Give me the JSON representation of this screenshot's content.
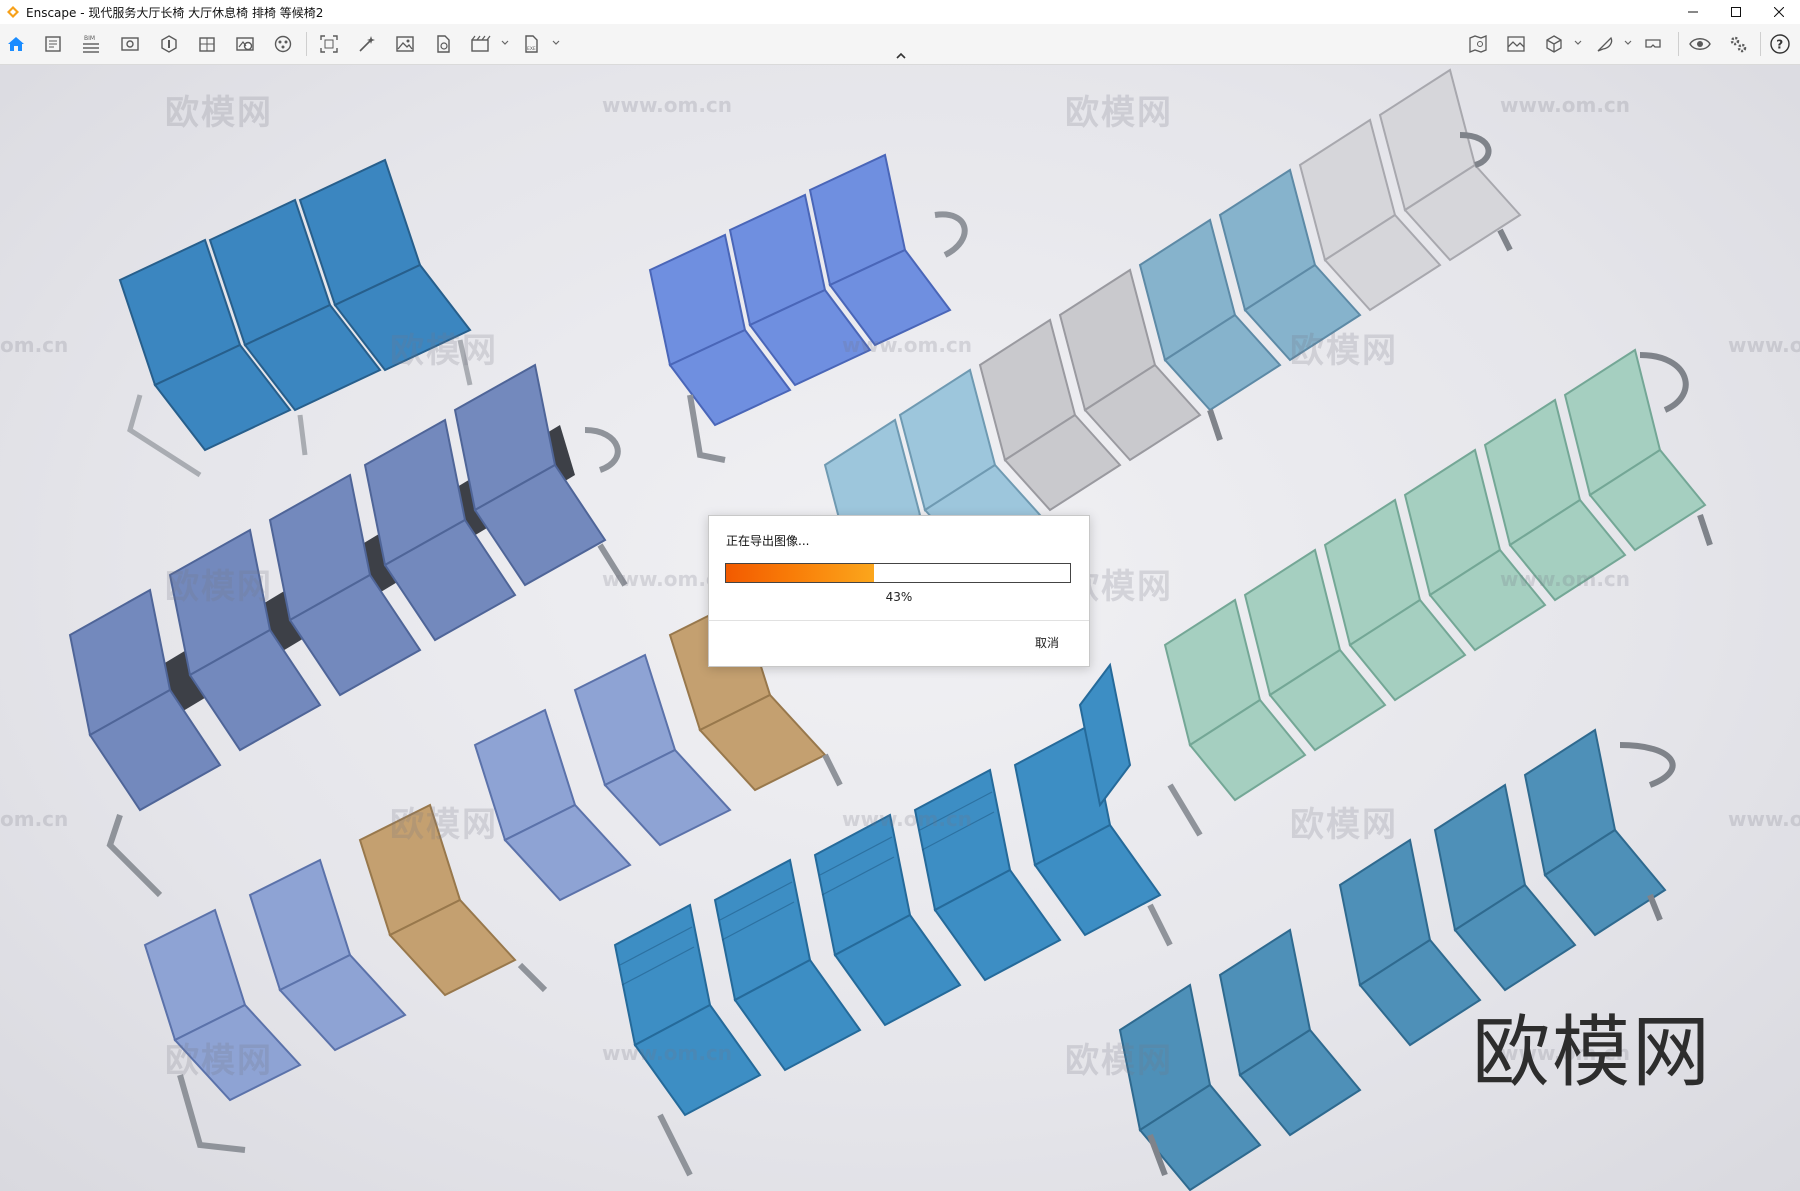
{
  "window": {
    "app_icon": "enscape-logo-icon",
    "title": "Enscape - 现代服务大厅长椅 大厅休息椅 排椅 等候椅2",
    "controls": [
      "minimize-icon",
      "maximize-icon",
      "close-icon"
    ]
  },
  "toolbar": {
    "left_icons": [
      "home-icon",
      "doc-properties-icon",
      "bim-icon",
      "preview-icon",
      "xray-icon",
      "building-icon",
      "scene-image-icon",
      "material-icon"
    ],
    "capture_icons": [
      "image-export-icon",
      "wand-icon",
      "photo-icon",
      "file-export-icon",
      "batch-render-icon",
      "exe-export-icon"
    ],
    "right_icons": [
      "map-icon",
      "landscape-icon",
      "cube-icon",
      "feather-icon",
      "vr-headset-icon",
      "eye-icon",
      "settings-icon",
      "help-icon"
    ],
    "collapse_icon": "chevron-up-icon"
  },
  "watermarks": {
    "site": "欧模网",
    "url": "www.om.cn",
    "url_fragment_left": "om.cn",
    "url_fragment_right": "www.o"
  },
  "brand_watermark": "欧模网",
  "export_dialog": {
    "title": "正在导出图像...",
    "progress": 0.43,
    "progress_label": "43%",
    "cancel_label": "取消"
  },
  "colors": {
    "accent_blue": "#1a8cff",
    "progress_start": "#f25a00",
    "progress_end": "#fba61c",
    "chair_blue": "#3b86c0",
    "chair_periwinkle": "#6f8fe0",
    "chair_lightblue": "#9dc6dc",
    "chair_gray": "#c8c8cc",
    "chair_mint": "#a5cfc0",
    "chair_slate": "#7389bd",
    "chair_tan": "#c4a070"
  }
}
